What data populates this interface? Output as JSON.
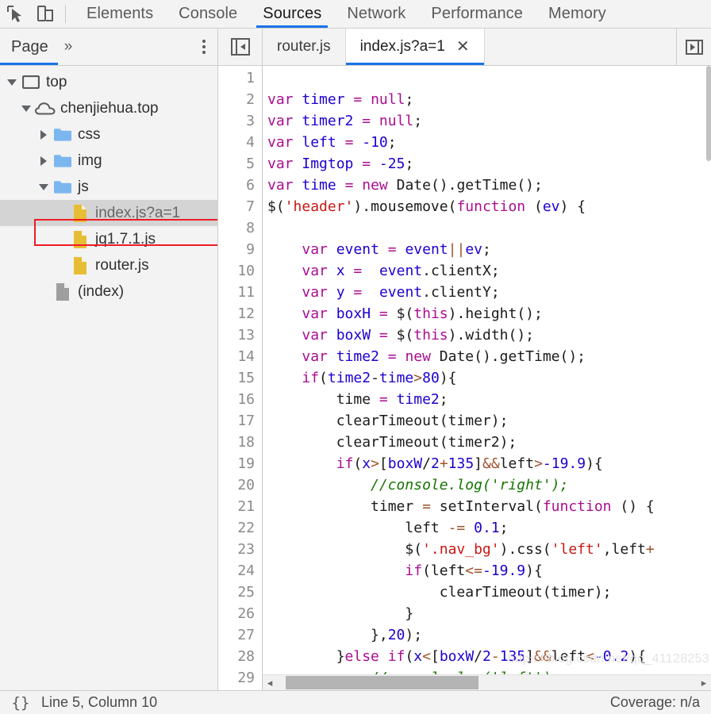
{
  "toolbar": {
    "inspect_icon": "inspect-cursor-icon",
    "device_icon": "device-toolbar-icon",
    "panels": [
      {
        "label": "Elements",
        "selected": false
      },
      {
        "label": "Console",
        "selected": false
      },
      {
        "label": "Sources",
        "selected": true
      },
      {
        "label": "Network",
        "selected": false
      },
      {
        "label": "Performance",
        "selected": false
      },
      {
        "label": "Memory",
        "selected": false
      }
    ]
  },
  "navigator": {
    "tab_label": "Page",
    "more_label": "»",
    "kebab_label": "more-options",
    "tree": [
      {
        "label": "top",
        "depth": 0,
        "twisty": "down",
        "icon": "frame-icon",
        "selected": false
      },
      {
        "label": "chenjiehua.top",
        "depth": 1,
        "twisty": "down",
        "icon": "cloud-icon",
        "selected": false
      },
      {
        "label": "css",
        "depth": 2,
        "twisty": "right",
        "icon": "folder-icon",
        "selected": false
      },
      {
        "label": "img",
        "depth": 2,
        "twisty": "right",
        "icon": "folder-icon",
        "selected": false
      },
      {
        "label": "js",
        "depth": 2,
        "twisty": "down",
        "icon": "folder-icon",
        "selected": false
      },
      {
        "label": "index.js?a=1",
        "depth": 3,
        "twisty": "none",
        "icon": "js-file-icon",
        "selected": true
      },
      {
        "label": "jq1.7.1.js",
        "depth": 3,
        "twisty": "none",
        "icon": "js-file-icon",
        "selected": false
      },
      {
        "label": "router.js",
        "depth": 3,
        "twisty": "none",
        "icon": "js-file-icon",
        "selected": false
      },
      {
        "label": "(index)",
        "depth": 2,
        "twisty": "none",
        "icon": "document-icon",
        "selected": false
      }
    ]
  },
  "editor": {
    "nav_toggle_icon": "show-navigator-icon",
    "tabs": [
      {
        "label": "router.js",
        "active": false,
        "closable": false
      },
      {
        "label": "index.js?a=1",
        "active": true,
        "closable": true,
        "close_label": "✕"
      }
    ],
    "more_tabs_icon": "more-tabs-icon",
    "first_line_number": 1,
    "line_count": 29,
    "scrollbar": {
      "left_arrow": "◂",
      "right_arrow": "▸",
      "thumb_left_pct": 2,
      "thumb_width_pct": 46
    }
  },
  "code": [
    {
      "n": 1,
      "tokens": []
    },
    {
      "n": 2,
      "tokens": [
        {
          "t": "var ",
          "c": "kw"
        },
        {
          "t": "timer",
          "c": "var"
        },
        {
          "t": " ",
          "c": "pl"
        },
        {
          "t": "=",
          "c": "op"
        },
        {
          "t": " ",
          "c": "pl"
        },
        {
          "t": "null",
          "c": "kw"
        },
        {
          "t": ";",
          "c": "pl"
        }
      ]
    },
    {
      "n": 3,
      "tokens": [
        {
          "t": "var ",
          "c": "kw"
        },
        {
          "t": "timer2",
          "c": "var"
        },
        {
          "t": " ",
          "c": "pl"
        },
        {
          "t": "=",
          "c": "op"
        },
        {
          "t": " ",
          "c": "pl"
        },
        {
          "t": "null",
          "c": "kw"
        },
        {
          "t": ";",
          "c": "pl"
        }
      ]
    },
    {
      "n": 4,
      "tokens": [
        {
          "t": "var ",
          "c": "kw"
        },
        {
          "t": "left",
          "c": "var"
        },
        {
          "t": " ",
          "c": "pl"
        },
        {
          "t": "=",
          "c": "op"
        },
        {
          "t": " ",
          "c": "pl"
        },
        {
          "t": "-10",
          "c": "num"
        },
        {
          "t": ";",
          "c": "pl"
        }
      ]
    },
    {
      "n": 5,
      "tokens": [
        {
          "t": "var ",
          "c": "kw"
        },
        {
          "t": "Imgtop",
          "c": "var"
        },
        {
          "t": " ",
          "c": "pl"
        },
        {
          "t": "=",
          "c": "op"
        },
        {
          "t": " ",
          "c": "pl"
        },
        {
          "t": "-25",
          "c": "num"
        },
        {
          "t": ";",
          "c": "pl"
        }
      ]
    },
    {
      "n": 6,
      "tokens": [
        {
          "t": "var ",
          "c": "kw"
        },
        {
          "t": "time",
          "c": "var"
        },
        {
          "t": " ",
          "c": "pl"
        },
        {
          "t": "=",
          "c": "op"
        },
        {
          "t": " ",
          "c": "pl"
        },
        {
          "t": "new",
          "c": "kw"
        },
        {
          "t": " Date().getTime();",
          "c": "pl"
        }
      ]
    },
    {
      "n": 7,
      "tokens": [
        {
          "t": "$(",
          "c": "pl"
        },
        {
          "t": "'header'",
          "c": "str"
        },
        {
          "t": ").mousemove(",
          "c": "pl"
        },
        {
          "t": "function",
          "c": "kw"
        },
        {
          "t": " (",
          "c": "pl"
        },
        {
          "t": "ev",
          "c": "var"
        },
        {
          "t": ") {",
          "c": "pl"
        }
      ]
    },
    {
      "n": 8,
      "tokens": []
    },
    {
      "n": 9,
      "tokens": [
        {
          "t": "    ",
          "c": "pl"
        },
        {
          "t": "var ",
          "c": "kw"
        },
        {
          "t": "event",
          "c": "var"
        },
        {
          "t": " ",
          "c": "pl"
        },
        {
          "t": "=",
          "c": "op"
        },
        {
          "t": " ",
          "c": "pl"
        },
        {
          "t": "event",
          "c": "var"
        },
        {
          "t": "||",
          "c": "op2"
        },
        {
          "t": "ev",
          "c": "var"
        },
        {
          "t": ";",
          "c": "pl"
        }
      ]
    },
    {
      "n": 10,
      "tokens": [
        {
          "t": "    ",
          "c": "pl"
        },
        {
          "t": "var ",
          "c": "kw"
        },
        {
          "t": "x",
          "c": "var"
        },
        {
          "t": " ",
          "c": "pl"
        },
        {
          "t": "=",
          "c": "op"
        },
        {
          "t": "  ",
          "c": "pl"
        },
        {
          "t": "event",
          "c": "var"
        },
        {
          "t": ".clientX;",
          "c": "pl"
        }
      ]
    },
    {
      "n": 11,
      "tokens": [
        {
          "t": "    ",
          "c": "pl"
        },
        {
          "t": "var ",
          "c": "kw"
        },
        {
          "t": "y",
          "c": "var"
        },
        {
          "t": " ",
          "c": "pl"
        },
        {
          "t": "=",
          "c": "op"
        },
        {
          "t": "  ",
          "c": "pl"
        },
        {
          "t": "event",
          "c": "var"
        },
        {
          "t": ".clientY;",
          "c": "pl"
        }
      ]
    },
    {
      "n": 12,
      "tokens": [
        {
          "t": "    ",
          "c": "pl"
        },
        {
          "t": "var ",
          "c": "kw"
        },
        {
          "t": "boxH",
          "c": "var"
        },
        {
          "t": " ",
          "c": "pl"
        },
        {
          "t": "=",
          "c": "op"
        },
        {
          "t": " $(",
          "c": "pl"
        },
        {
          "t": "this",
          "c": "kw"
        },
        {
          "t": ").height();",
          "c": "pl"
        }
      ]
    },
    {
      "n": 13,
      "tokens": [
        {
          "t": "    ",
          "c": "pl"
        },
        {
          "t": "var ",
          "c": "kw"
        },
        {
          "t": "boxW",
          "c": "var"
        },
        {
          "t": " ",
          "c": "pl"
        },
        {
          "t": "=",
          "c": "op"
        },
        {
          "t": " $(",
          "c": "pl"
        },
        {
          "t": "this",
          "c": "kw"
        },
        {
          "t": ").width();",
          "c": "pl"
        }
      ]
    },
    {
      "n": 14,
      "tokens": [
        {
          "t": "    ",
          "c": "pl"
        },
        {
          "t": "var ",
          "c": "kw"
        },
        {
          "t": "time2",
          "c": "var"
        },
        {
          "t": " ",
          "c": "pl"
        },
        {
          "t": "=",
          "c": "op"
        },
        {
          "t": " ",
          "c": "pl"
        },
        {
          "t": "new",
          "c": "kw"
        },
        {
          "t": " Date().getTime();",
          "c": "pl"
        }
      ]
    },
    {
      "n": 15,
      "tokens": [
        {
          "t": "    ",
          "c": "pl"
        },
        {
          "t": "if",
          "c": "kw"
        },
        {
          "t": "(",
          "c": "pl"
        },
        {
          "t": "time2",
          "c": "var"
        },
        {
          "t": "-",
          "c": "pl"
        },
        {
          "t": "time",
          "c": "var"
        },
        {
          "t": ">",
          "c": "op2"
        },
        {
          "t": "80",
          "c": "num"
        },
        {
          "t": "){",
          "c": "pl"
        }
      ]
    },
    {
      "n": 16,
      "tokens": [
        {
          "t": "        time ",
          "c": "pl"
        },
        {
          "t": "=",
          "c": "op"
        },
        {
          "t": " ",
          "c": "pl"
        },
        {
          "t": "time2",
          "c": "var"
        },
        {
          "t": ";",
          "c": "pl"
        }
      ]
    },
    {
      "n": 17,
      "tokens": [
        {
          "t": "        clearTimeout(timer);",
          "c": "pl"
        }
      ]
    },
    {
      "n": 18,
      "tokens": [
        {
          "t": "        clearTimeout(timer2);",
          "c": "pl"
        }
      ]
    },
    {
      "n": 19,
      "tokens": [
        {
          "t": "        ",
          "c": "pl"
        },
        {
          "t": "if",
          "c": "kw"
        },
        {
          "t": "(",
          "c": "pl"
        },
        {
          "t": "x",
          "c": "var"
        },
        {
          "t": ">",
          "c": "op2"
        },
        {
          "t": "[",
          "c": "pl"
        },
        {
          "t": "boxW",
          "c": "var"
        },
        {
          "t": "/",
          "c": "pl"
        },
        {
          "t": "2",
          "c": "num"
        },
        {
          "t": "+",
          "c": "op2"
        },
        {
          "t": "135",
          "c": "num"
        },
        {
          "t": "]",
          "c": "pl"
        },
        {
          "t": "&&",
          "c": "op2"
        },
        {
          "t": "left",
          "c": "pl"
        },
        {
          "t": ">",
          "c": "op2"
        },
        {
          "t": "-19.9",
          "c": "num"
        },
        {
          "t": "){",
          "c": "pl"
        }
      ]
    },
    {
      "n": 20,
      "tokens": [
        {
          "t": "            //console.log('right');",
          "c": "com"
        }
      ]
    },
    {
      "n": 21,
      "tokens": [
        {
          "t": "            timer ",
          "c": "pl"
        },
        {
          "t": "=",
          "c": "op2"
        },
        {
          "t": " setInterval(",
          "c": "pl"
        },
        {
          "t": "function",
          "c": "kw"
        },
        {
          "t": " () {",
          "c": "pl"
        }
      ]
    },
    {
      "n": 22,
      "tokens": [
        {
          "t": "                left ",
          "c": "pl"
        },
        {
          "t": "-=",
          "c": "op2"
        },
        {
          "t": " ",
          "c": "pl"
        },
        {
          "t": "0.1",
          "c": "num"
        },
        {
          "t": ";",
          "c": "pl"
        }
      ]
    },
    {
      "n": 23,
      "tokens": [
        {
          "t": "                $(",
          "c": "pl"
        },
        {
          "t": "'.nav_bg'",
          "c": "str"
        },
        {
          "t": ").css(",
          "c": "pl"
        },
        {
          "t": "'left'",
          "c": "str"
        },
        {
          "t": ",left",
          "c": "pl"
        },
        {
          "t": "+",
          "c": "op2"
        },
        {
          "t": "",
          "c": "pl"
        }
      ]
    },
    {
      "n": 24,
      "tokens": [
        {
          "t": "                ",
          "c": "pl"
        },
        {
          "t": "if",
          "c": "kw"
        },
        {
          "t": "(left",
          "c": "pl"
        },
        {
          "t": "<=",
          "c": "op2"
        },
        {
          "t": "-19.9",
          "c": "num"
        },
        {
          "t": "){",
          "c": "pl"
        }
      ]
    },
    {
      "n": 25,
      "tokens": [
        {
          "t": "                    clearTimeout(timer);",
          "c": "pl"
        }
      ]
    },
    {
      "n": 26,
      "tokens": [
        {
          "t": "                }",
          "c": "pl"
        }
      ]
    },
    {
      "n": 27,
      "tokens": [
        {
          "t": "            },",
          "c": "pl"
        },
        {
          "t": "20",
          "c": "num"
        },
        {
          "t": ");",
          "c": "pl"
        }
      ]
    },
    {
      "n": 28,
      "tokens": [
        {
          "t": "        }",
          "c": "pl"
        },
        {
          "t": "else",
          "c": "kw"
        },
        {
          "t": " ",
          "c": "pl"
        },
        {
          "t": "if",
          "c": "kw"
        },
        {
          "t": "(",
          "c": "pl"
        },
        {
          "t": "x",
          "c": "var"
        },
        {
          "t": "<",
          "c": "op2"
        },
        {
          "t": "[",
          "c": "pl"
        },
        {
          "t": "boxW",
          "c": "var"
        },
        {
          "t": "/",
          "c": "pl"
        },
        {
          "t": "2",
          "c": "num"
        },
        {
          "t": "-",
          "c": "op2"
        },
        {
          "t": "135",
          "c": "num"
        },
        {
          "t": "]",
          "c": "pl"
        },
        {
          "t": "&&",
          "c": "op2"
        },
        {
          "t": "left",
          "c": "pl"
        },
        {
          "t": "<",
          "c": "op2"
        },
        {
          "t": "-0.2",
          "c": "num"
        },
        {
          "t": "){",
          "c": "pl"
        }
      ]
    },
    {
      "n": 29,
      "tokens": [
        {
          "t": "            //console.log('left');",
          "c": "com"
        }
      ]
    }
  ],
  "status_bar": {
    "pretty_print_label": "{}",
    "position_text": "Line 5, Column 10",
    "coverage_label": "Coverage: n/a"
  },
  "watermark": "https://blog.csdn.net/qq_41128253",
  "colors": {
    "accent": "#1a73e8",
    "chrome_bg": "#f3f3f3",
    "selection_bg": "#d4d4d4",
    "annotation_red": "#ee1c25",
    "folder_blue": "#7cb6ef",
    "js_file_yellow": "#e8bd36",
    "keyword_magenta": "#aa0d91",
    "variable_blue": "#1c00cf",
    "string_red": "#c41a16",
    "comment_green": "#177500",
    "operator_brown": "#a0522d"
  }
}
